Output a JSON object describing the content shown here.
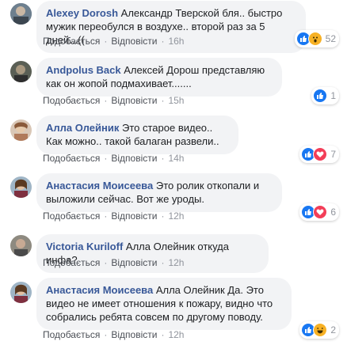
{
  "labels": {
    "like": "Подобається",
    "reply": "Відповісти"
  },
  "comments": [
    {
      "author": "Alexey Dorosh",
      "text": "Александр Тверской бля.. быстро мужик переобулся в воздухе.. второй раз за 5 дней...((",
      "time": "16h",
      "reactions": {
        "icons": [
          "like-icon",
          "wow-icon"
        ],
        "count": "52"
      }
    },
    {
      "author": "Andpolus Back",
      "text": "Алексей Дорош представляю как он жопой подмахивает.......",
      "time": "15h",
      "reactions": {
        "icons": [
          "like-icon"
        ],
        "count": "1"
      }
    },
    {
      "author": "Алла Олейник",
      "text": "Это старое видео.. Как можно.. такой балаган развели..",
      "time": "14h",
      "reactions": {
        "icons": [
          "like-icon",
          "love-icon"
        ],
        "count": "7"
      }
    },
    {
      "author": "Анастасия Моисеева",
      "text": "Это ролик откопали и выложили сейчас. Вот же уроды.",
      "time": "12h",
      "reactions": {
        "icons": [
          "like-icon",
          "love-icon"
        ],
        "count": "6"
      }
    },
    {
      "author": "Victoria Kuriloff",
      "text": "Алла Олейник откуда инфа?",
      "time": "12h",
      "reactions": null
    },
    {
      "author": "Анастасия Моисеева",
      "text": "Алла Олейник Да. Это видео не имеет отношения к пожару, видно что собрались ребята совсем по другому поводу.",
      "time": "12h",
      "reactions": {
        "icons": [
          "like-icon",
          "haha-icon"
        ],
        "count": "2"
      }
    }
  ],
  "colors": {
    "author": "#385898",
    "bubble": "#f2f3f5",
    "like": "#1877f2",
    "love": "#f33e58",
    "wow": "#f7b125"
  }
}
